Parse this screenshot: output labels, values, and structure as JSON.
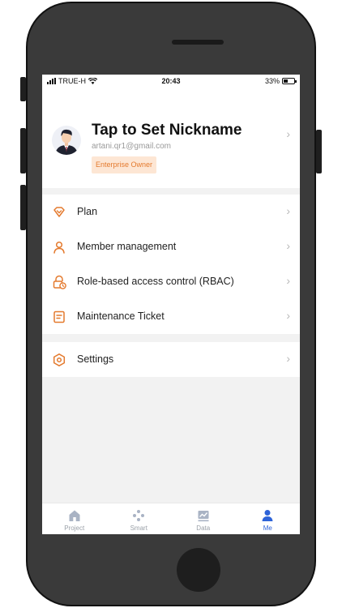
{
  "status_bar": {
    "carrier": "TRUE-H",
    "time": "20:43",
    "battery": "33%"
  },
  "profile": {
    "nickname": "Tap to Set Nickname",
    "email": "artani.qr1@gmail.com",
    "role_badge": "Enterprise Owner"
  },
  "menu_group_1": [
    {
      "label": "Plan",
      "icon": "diamond-icon"
    },
    {
      "label": "Member management",
      "icon": "user-icon"
    },
    {
      "label": "Role-based access control (RBAC)",
      "icon": "lock-clock-icon"
    },
    {
      "label": "Maintenance Ticket",
      "icon": "ticket-icon"
    }
  ],
  "menu_group_2": [
    {
      "label": "Settings",
      "icon": "hexagon-settings-icon"
    }
  ],
  "tabbar": [
    {
      "label": "Project",
      "icon": "home-icon",
      "active": false
    },
    {
      "label": "Smart",
      "icon": "dots-icon",
      "active": false
    },
    {
      "label": "Data",
      "icon": "chart-icon",
      "active": false
    },
    {
      "label": "Me",
      "icon": "person-icon",
      "active": true
    }
  ],
  "colors": {
    "accent_orange": "#e47a2e",
    "active_blue": "#2d63d8",
    "inactive_tab": "#9aa0a8"
  }
}
